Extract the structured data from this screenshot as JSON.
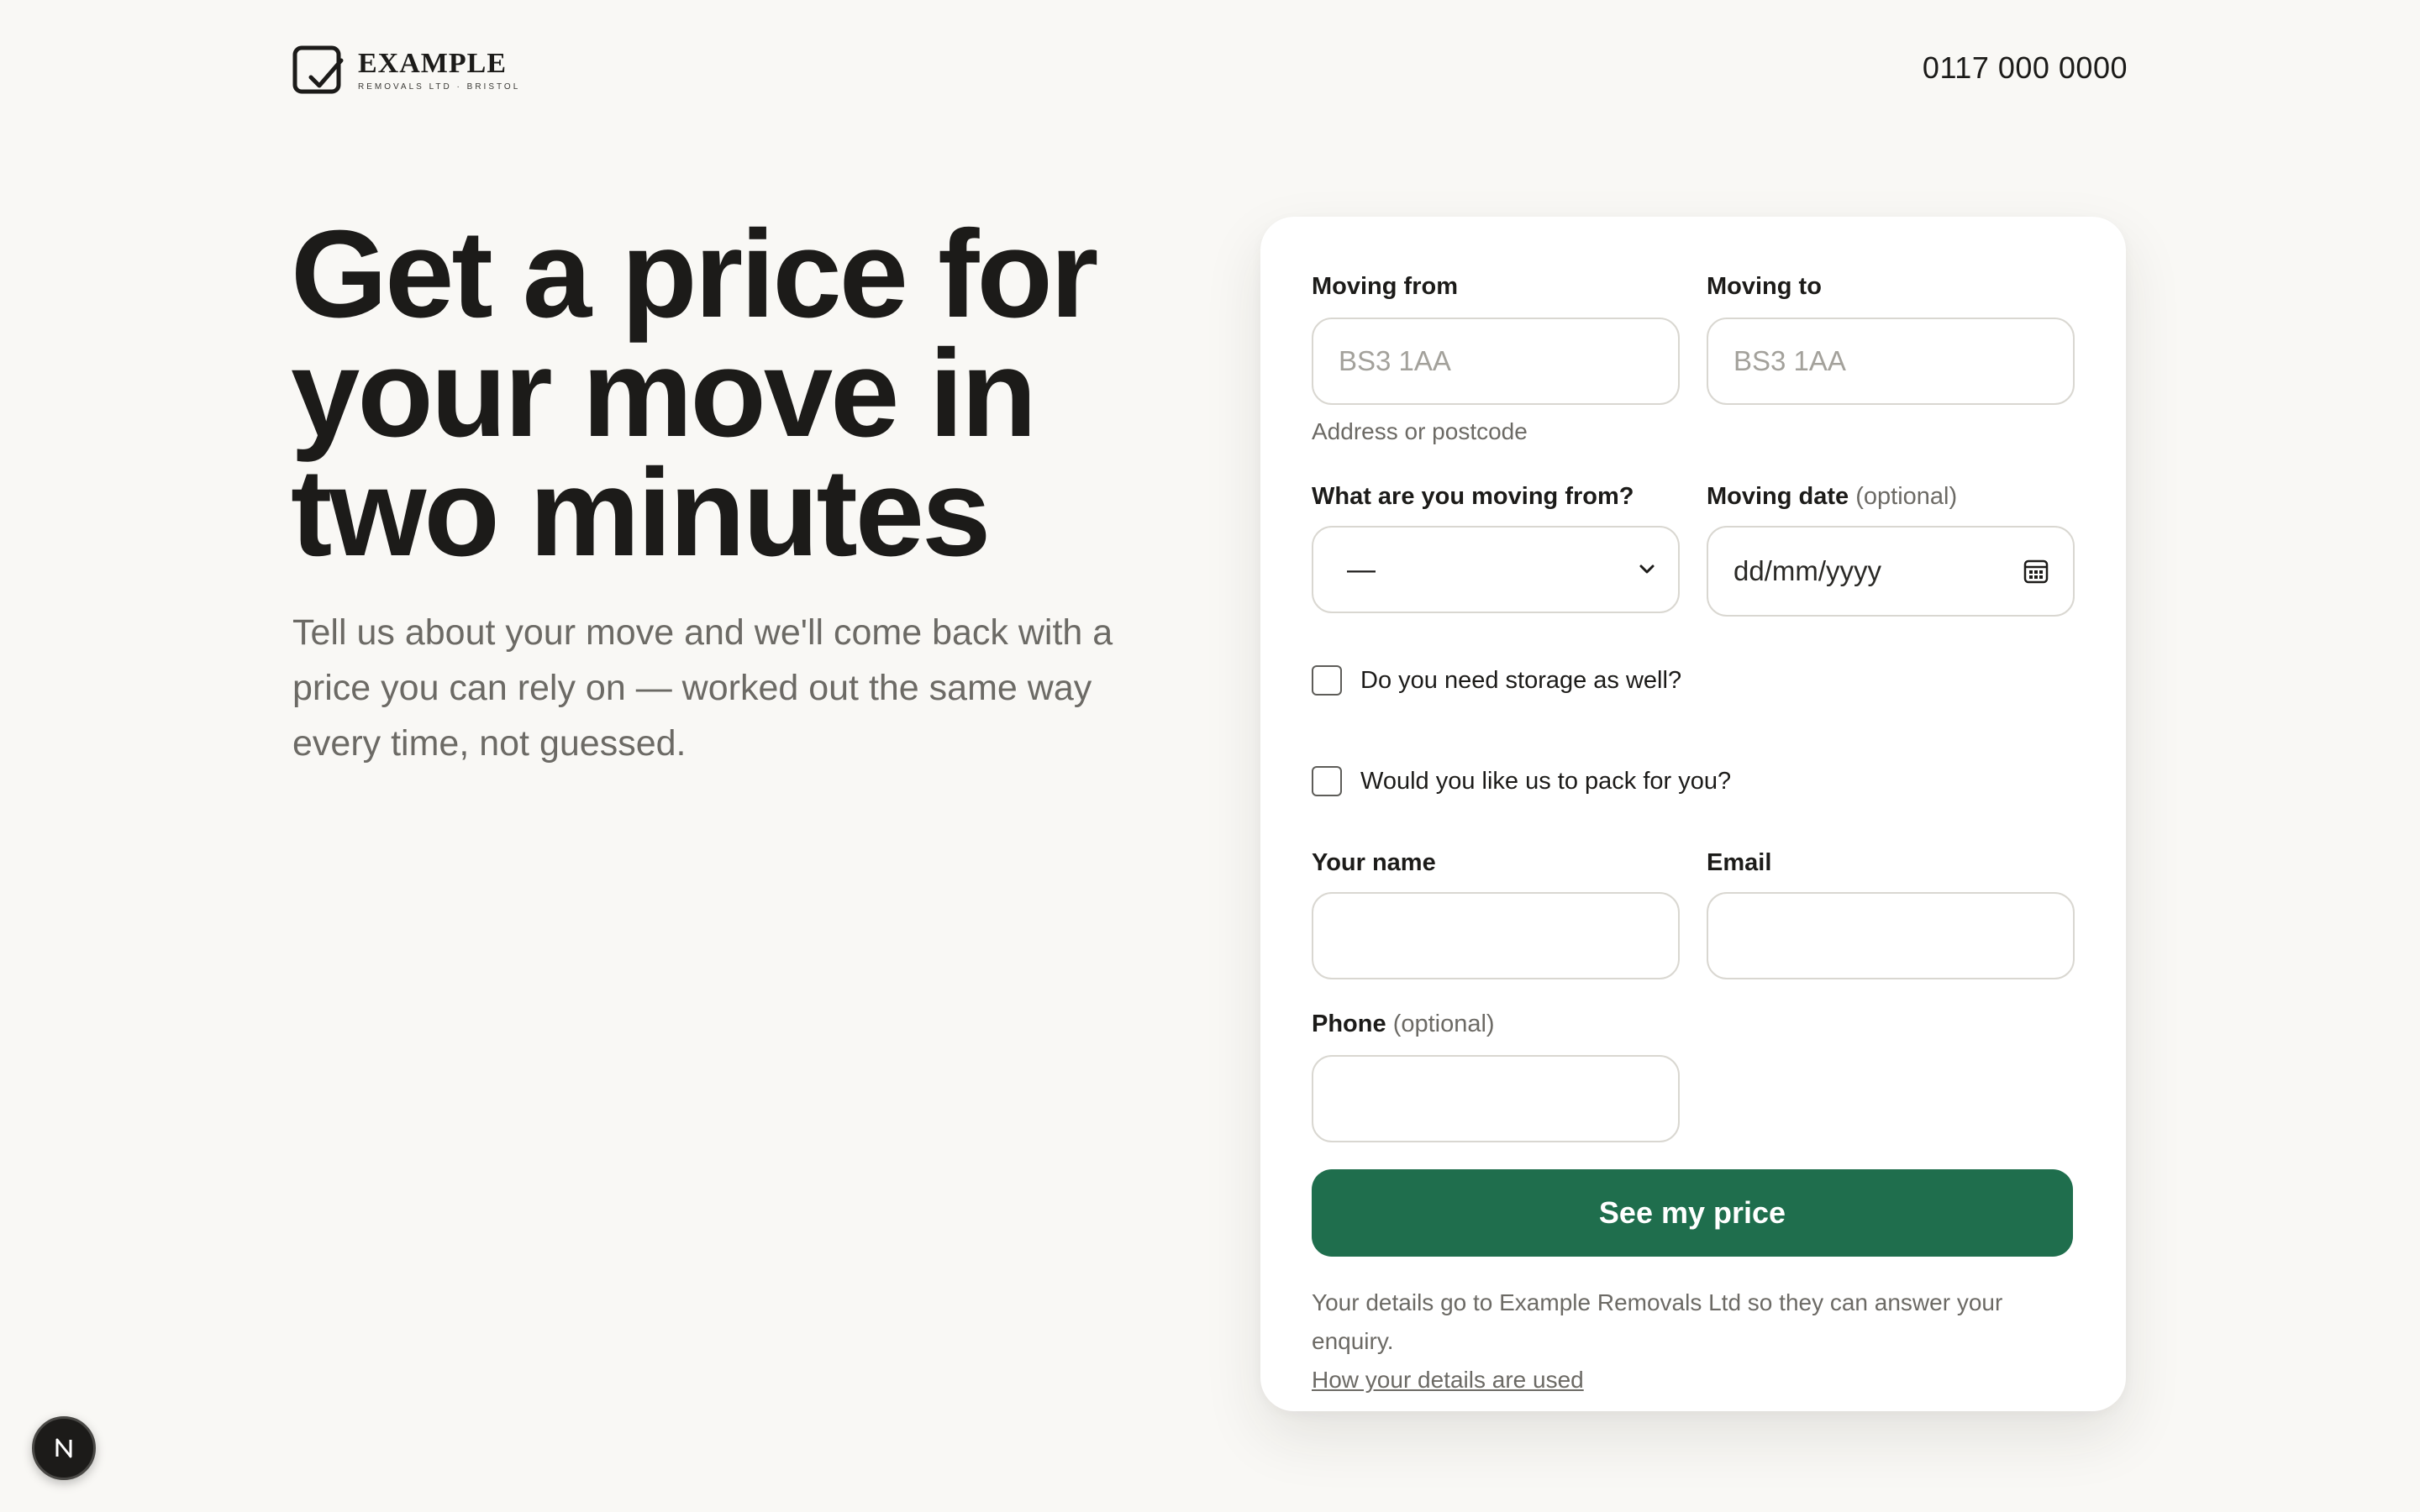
{
  "header": {
    "brand_name": "EXAMPLE",
    "brand_sub": "REMOVALS LTD · BRISTOL",
    "phone": "0117 000 0000"
  },
  "hero": {
    "title": "Get a price for your move in two minutes",
    "subtitle": "Tell us about your move and we'll come back with a price you can rely on — worked out the same way every time, not guessed."
  },
  "form": {
    "moving_from": {
      "label": "Moving from",
      "placeholder": "BS3 1AA",
      "value": ""
    },
    "moving_to": {
      "label": "Moving to",
      "placeholder": "BS3 1AA",
      "value": ""
    },
    "address_hint": "Address or postcode",
    "property_type": {
      "label": "What are you moving from?",
      "selected": "—"
    },
    "moving_date": {
      "label": "Moving date",
      "optional": "(optional)",
      "placeholder": "dd/mm/yyyy"
    },
    "storage_checkbox": {
      "label": "Do you need storage as well?",
      "checked": false
    },
    "packing_checkbox": {
      "label": "Would you like us to pack for you?",
      "checked": false
    },
    "name": {
      "label": "Your name",
      "value": ""
    },
    "email": {
      "label": "Email",
      "value": ""
    },
    "phone": {
      "label": "Phone",
      "optional": "(optional)",
      "value": ""
    },
    "submit_label": "See my price",
    "disclaimer": "Your details go to Example Removals Ltd so they can answer your enquiry.",
    "details_link": "How your details are used"
  },
  "badge": {
    "letter": "N"
  },
  "colors": {
    "background": "#f9f8f5",
    "accent": "#1f6e4d",
    "text": "#1c1b19",
    "muted": "#6c6a65"
  }
}
